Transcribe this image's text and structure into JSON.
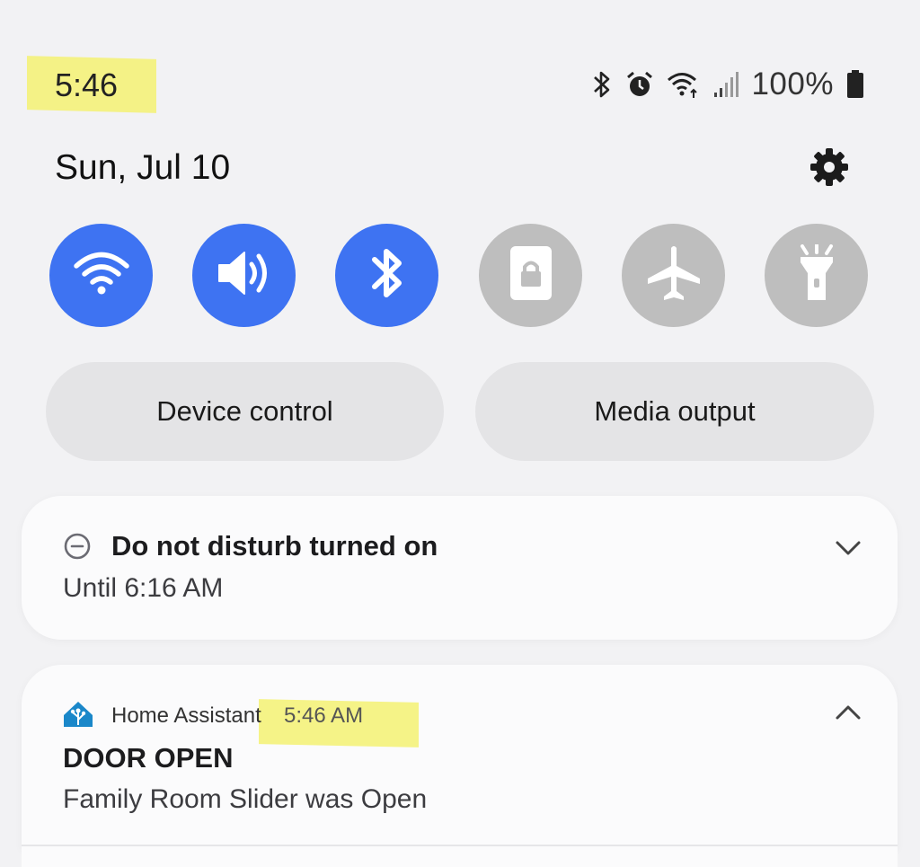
{
  "status_bar": {
    "time": "5:46",
    "battery_percent": "100%",
    "icons": [
      "bluetooth-icon",
      "alarm-icon",
      "wifi-icon",
      "signal-icon",
      "battery-icon"
    ]
  },
  "header": {
    "date": "Sun, Jul 10",
    "settings_icon": "gear-icon"
  },
  "quick_toggles": [
    {
      "name": "wifi",
      "icon": "wifi-icon",
      "state": "on"
    },
    {
      "name": "sound",
      "icon": "speaker-icon",
      "state": "on"
    },
    {
      "name": "bluetooth",
      "icon": "bluetooth-icon",
      "state": "on"
    },
    {
      "name": "portrait-lock",
      "icon": "lock-icon",
      "state": "off"
    },
    {
      "name": "airplane-mode",
      "icon": "airplane-icon",
      "state": "off"
    },
    {
      "name": "flashlight",
      "icon": "flashlight-icon",
      "state": "off"
    }
  ],
  "buttons": {
    "device_control": "Device control",
    "media_output": "Media output"
  },
  "notifications": {
    "dnd": {
      "title": "Do not disturb turned on",
      "subtitle": "Until 6:16 AM"
    },
    "home_assistant": {
      "app_name": "Home Assistant",
      "time": "5:46 AM",
      "title": "DOOR OPEN",
      "body": "Family Room Slider was Open"
    }
  },
  "colors": {
    "toggle_on": "#3e73f2",
    "toggle_off": "#bebebe",
    "highlight": "#f4f27a",
    "ha_brand": "#1a87c9"
  }
}
